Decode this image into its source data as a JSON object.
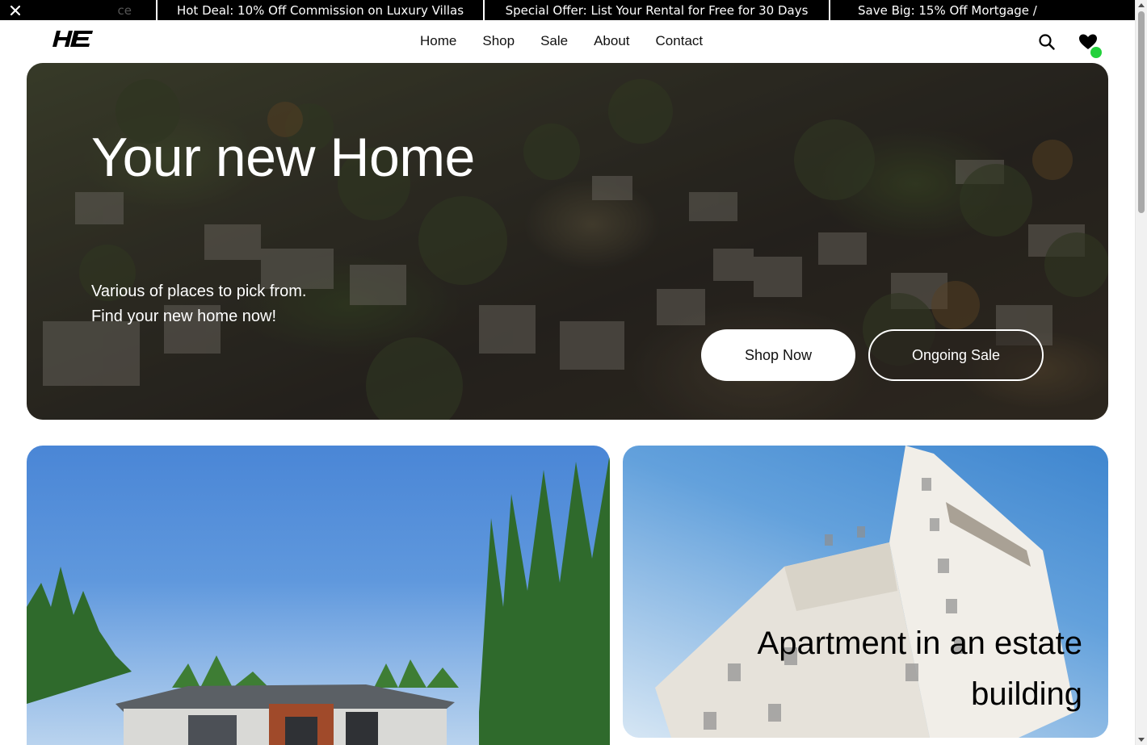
{
  "ticker": {
    "close_icon": "close-icon",
    "items": [
      "ce",
      "Hot Deal: 10% Off Commission on Luxury Villas",
      "Special Offer: List Your Rental for Free for 30 Days",
      "Save Big: 15% Off Mortgage /"
    ]
  },
  "header": {
    "logo": "HE",
    "nav": [
      "Home",
      "Shop",
      "Sale",
      "About",
      "Contact"
    ],
    "search_icon": "search-icon",
    "wishlist_icon": "heart-icon",
    "accent_color": "#22d13b"
  },
  "hero": {
    "title": "Your new Home",
    "subtitle": "Various of places to pick from. Find your new home now!",
    "shop_button": "Shop Now",
    "sale_button": "Ongoing Sale"
  },
  "cards": {
    "right_title": "Apartment in an estate building"
  }
}
